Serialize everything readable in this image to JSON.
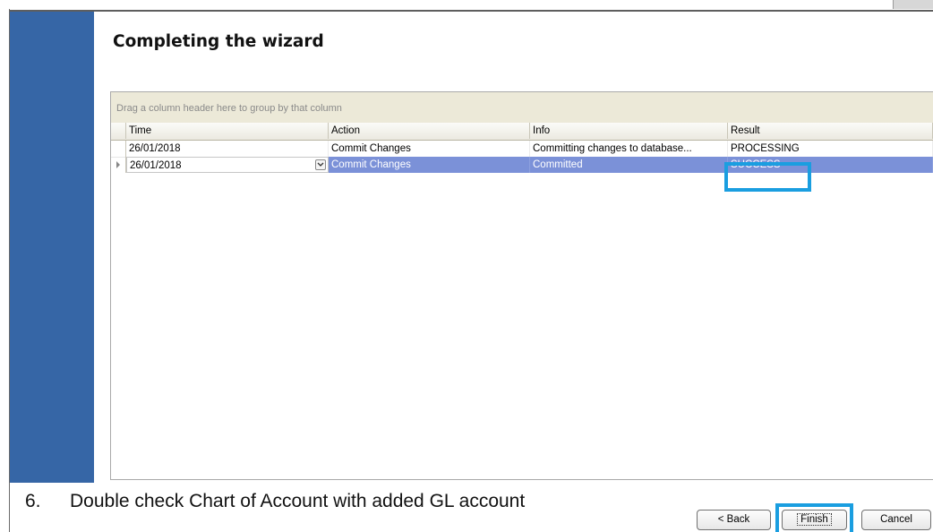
{
  "wizard": {
    "title": "Completing the wizard"
  },
  "grid": {
    "group_hint": "Drag a column header here to group by that column",
    "columns": [
      "Time",
      "Action",
      "Info",
      "Result"
    ],
    "rows": [
      {
        "time": "26/01/2018",
        "action": "Commit Changes",
        "info": "Committing changes to database...",
        "result": "PROCESSING"
      },
      {
        "time": "26/01/2018",
        "action": "Commit Changes",
        "info": "Committed",
        "result": "SUCCESS"
      }
    ]
  },
  "instruction": {
    "number": "6.",
    "text": "Double check Chart of Account with added GL account"
  },
  "buttons": {
    "back": "< Back",
    "finish": "Finish",
    "cancel": "Cancel"
  },
  "colors": {
    "sidebar": "#3666a6",
    "selected_row": "#7b91d8",
    "highlight": "#1a9ee0"
  },
  "icons": [
    "row-pointer-icon",
    "chevron-down-icon"
  ]
}
